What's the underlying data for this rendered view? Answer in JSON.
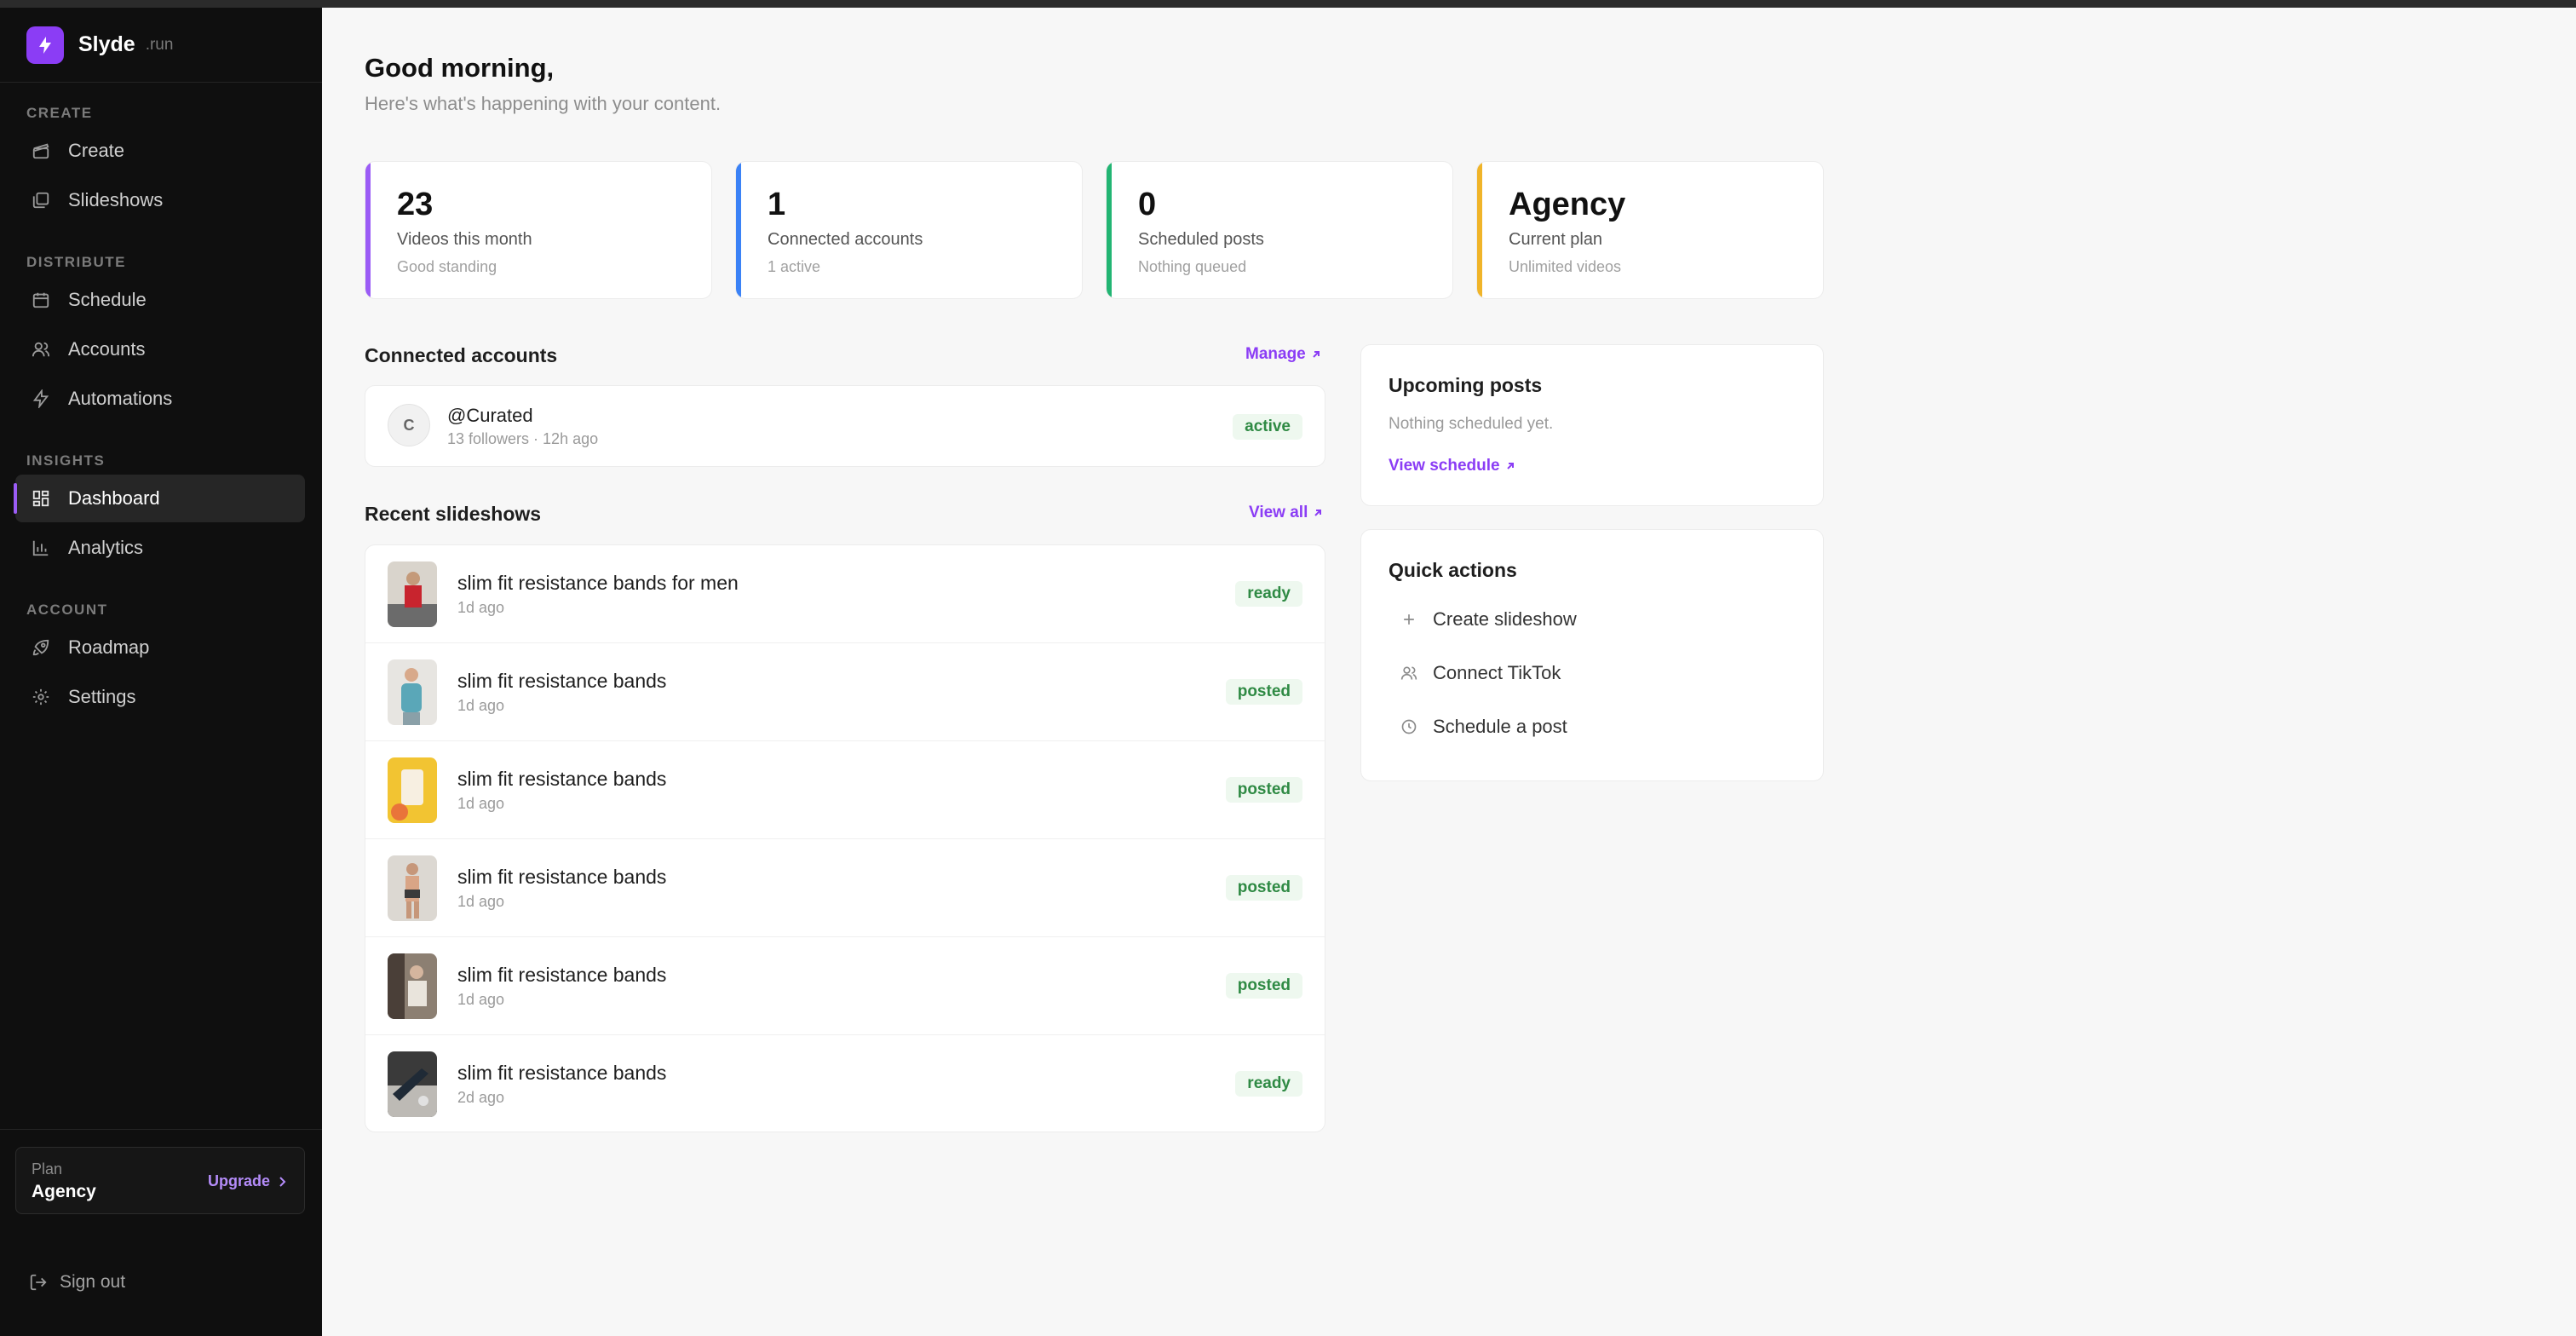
{
  "brand": {
    "name": "Slyde",
    "tld": ".run",
    "accent": "#8b3df5"
  },
  "nav": {
    "sections": [
      {
        "label": "CREATE",
        "items": [
          {
            "label": "Create",
            "icon": "clapperboard-icon"
          },
          {
            "label": "Slideshows",
            "icon": "images-icon"
          }
        ]
      },
      {
        "label": "DISTRIBUTE",
        "items": [
          {
            "label": "Schedule",
            "icon": "calendar-icon"
          },
          {
            "label": "Accounts",
            "icon": "users-icon"
          },
          {
            "label": "Automations",
            "icon": "bolt-icon"
          }
        ]
      },
      {
        "label": "INSIGHTS",
        "items": [
          {
            "label": "Dashboard",
            "icon": "grid-icon",
            "active": true
          },
          {
            "label": "Analytics",
            "icon": "bar-chart-icon"
          }
        ]
      },
      {
        "label": "ACCOUNT",
        "items": [
          {
            "label": "Roadmap",
            "icon": "rocket-icon"
          },
          {
            "label": "Settings",
            "icon": "gear-icon"
          }
        ]
      }
    ]
  },
  "plan": {
    "label": "Plan",
    "value": "Agency",
    "upgrade_label": "Upgrade"
  },
  "signout_label": "Sign out",
  "greeting": {
    "title": "Good morning,",
    "subtitle": "Here's what's happening with your content."
  },
  "stats": [
    {
      "value": "23",
      "label": "Videos this month",
      "sub": "Good standing",
      "color": "#9b5cf6"
    },
    {
      "value": "1",
      "label": "Connected accounts",
      "sub": "1 active",
      "color": "#3b82f6"
    },
    {
      "value": "0",
      "label": "Scheduled posts",
      "sub": "Nothing queued",
      "color": "#22b573"
    },
    {
      "value": "Agency",
      "label": "Current plan",
      "sub": "Unlimited videos",
      "color": "#f0b429"
    }
  ],
  "connected_accounts": {
    "title": "Connected accounts",
    "link": "Manage",
    "accounts": [
      {
        "initial": "C",
        "handle": "@Curated",
        "meta": "13 followers · 12h ago",
        "status": "active"
      }
    ]
  },
  "recent_slideshows": {
    "title": "Recent slideshows",
    "link": "View all",
    "items": [
      {
        "title": "slim fit resistance bands for men",
        "time": "1d ago",
        "status": "ready"
      },
      {
        "title": "slim fit resistance bands",
        "time": "1d ago",
        "status": "posted"
      },
      {
        "title": "slim fit resistance bands",
        "time": "1d ago",
        "status": "posted"
      },
      {
        "title": "slim fit resistance bands",
        "time": "1d ago",
        "status": "posted"
      },
      {
        "title": "slim fit resistance bands",
        "time": "1d ago",
        "status": "posted"
      },
      {
        "title": "slim fit resistance bands",
        "time": "2d ago",
        "status": "ready"
      }
    ]
  },
  "upcoming": {
    "title": "Upcoming posts",
    "empty": "Nothing scheduled yet.",
    "link": "View schedule"
  },
  "quick_actions": {
    "title": "Quick actions",
    "items": [
      {
        "label": "Create slideshow",
        "icon": "plus-icon"
      },
      {
        "label": "Connect TikTok",
        "icon": "users-icon"
      },
      {
        "label": "Schedule a post",
        "icon": "clock-icon"
      }
    ]
  }
}
